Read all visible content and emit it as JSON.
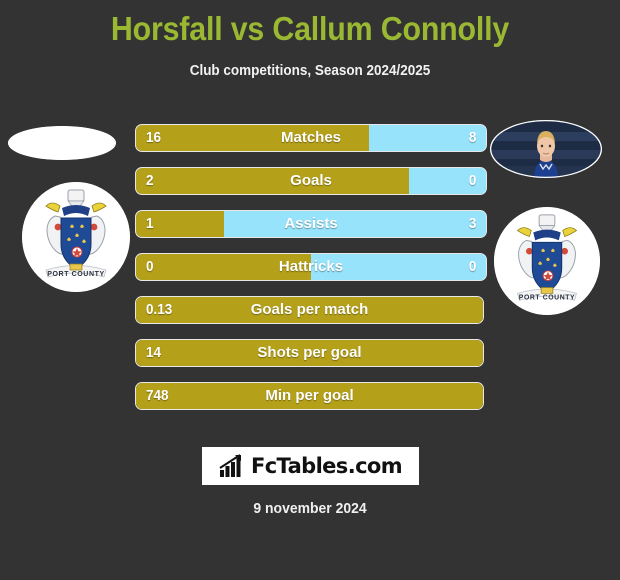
{
  "header": {
    "title": "Horsfall vs Callum Connolly",
    "subtitle": "Club competitions, Season 2024/2025"
  },
  "media": {
    "home_photo": "player-photo-placeholder",
    "home_crest": "stockport-county-crest",
    "away_photo": "player-photo-callum-connolly",
    "away_crest": "stockport-county-crest"
  },
  "chart_data": {
    "type": "bar",
    "title": "Horsfall vs Callum Connolly",
    "subtitle": "Club competitions, Season 2024/2025",
    "layout": "diverging-comparison-bars",
    "series": [
      {
        "name": "Horsfall",
        "color": "#b5a01a"
      },
      {
        "name": "Callum Connolly",
        "color": "#96e3fb"
      }
    ],
    "categories": [
      "Matches",
      "Goals",
      "Assists",
      "Hattricks",
      "Goals per match",
      "Shots per goal",
      "Min per goal"
    ],
    "rows": [
      {
        "label": "Matches",
        "home": "16",
        "away": "8",
        "home_pct": 66.7,
        "dual": true
      },
      {
        "label": "Goals",
        "home": "2",
        "away": "0",
        "home_pct": 78.0,
        "dual": true
      },
      {
        "label": "Assists",
        "home": "1",
        "away": "3",
        "home_pct": 25.0,
        "dual": true
      },
      {
        "label": "Hattricks",
        "home": "0",
        "away": "0",
        "home_pct": 50.0,
        "dual": true
      },
      {
        "label": "Goals per match",
        "home": "0.13",
        "away": "",
        "home_pct": 100,
        "dual": false
      },
      {
        "label": "Shots per goal",
        "home": "14",
        "away": "",
        "home_pct": 100,
        "dual": false
      },
      {
        "label": "Min per goal",
        "home": "748",
        "away": "",
        "home_pct": 100,
        "dual": false
      }
    ]
  },
  "footer": {
    "logo_text": "FcTables.com",
    "logo_icon": "bar-chart-icon",
    "date": "9 november 2024"
  },
  "colors": {
    "background": "#333333",
    "title": "#9ab832",
    "home_bar": "#b5a01a",
    "away_bar": "#96e3fb",
    "bar_border": "#e8e8e8",
    "text": "#ffffff"
  }
}
